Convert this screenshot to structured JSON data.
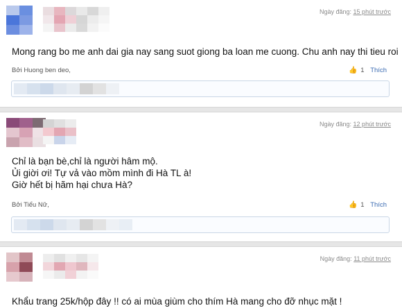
{
  "comments": [
    {
      "timestamp_prefix": "Ngày đăng:",
      "timestamp_ago": "15 phút trước",
      "text_lines": [
        "Mong rang bo me anh dai gia nay sang suot giong ba loan me cuong. Chu anh nay thi tieu roi"
      ],
      "author": "Bởi Huong ben deo,",
      "likes": "1",
      "like_label": "Thích"
    },
    {
      "timestamp_prefix": "Ngày đăng:",
      "timestamp_ago": "12 phút trước",
      "text_lines": [
        "Chỉ là bạn bè,chỉ là người hâm mộ.",
        "Ủi giời ơi! Tự vả vào mồm mình đi Hà TL à!",
        "Giờ hết bị hãm hại chưa Hà?"
      ],
      "author": "Bởi Tiểu Nữ,",
      "likes": "1",
      "like_label": "Thích"
    },
    {
      "timestamp_prefix": "Ngày đăng:",
      "timestamp_ago": "11 phút trước",
      "text_lines": [
        "Khẩu trang 25k/hộp đây !! có ai mùa giùm cho thím Hà mang cho đỡ nhục mặt !"
      ]
    }
  ],
  "colors": {
    "link": "#3b6bb2",
    "separator": "#e6e6e6",
    "reply_border": "#c9d6e6"
  },
  "icons": {
    "like": "thumbs-up-icon"
  }
}
